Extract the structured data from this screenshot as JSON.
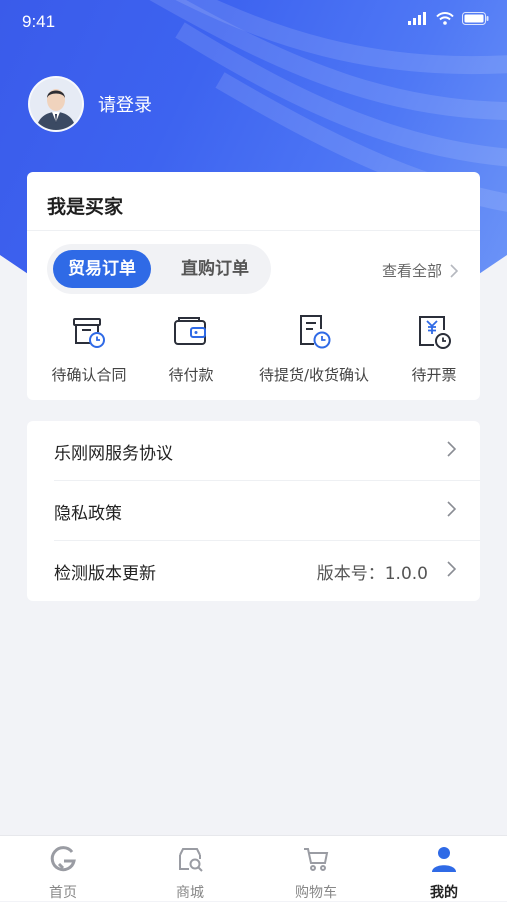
{
  "status_bar": {
    "time": "9:41"
  },
  "profile": {
    "login_text": "请登录"
  },
  "buyer_card": {
    "title": "我是买家",
    "tabs": [
      {
        "label": "贸易订单",
        "active": true
      },
      {
        "label": "直购订单",
        "active": false
      }
    ],
    "view_all": "查看全部",
    "statuses": [
      {
        "label": "待确认合同",
        "icon": "contract-clock-icon"
      },
      {
        "label": "待付款",
        "icon": "wallet-icon"
      },
      {
        "label": "待提货/收货确认",
        "icon": "document-clock-icon"
      },
      {
        "label": "待开票",
        "icon": "invoice-yen-icon"
      }
    ]
  },
  "menu": [
    {
      "label": "乐刚网服务协议",
      "value": ""
    },
    {
      "label": "隐私政策",
      "value": ""
    },
    {
      "label": "检测版本更新",
      "value": "版本号：1.0.0"
    }
  ],
  "tabbar": [
    {
      "label": "首页",
      "icon": "home-g-icon",
      "active": false
    },
    {
      "label": "商城",
      "icon": "store-search-icon",
      "active": false
    },
    {
      "label": "购物车",
      "icon": "cart-icon",
      "active": false
    },
    {
      "label": "我的",
      "icon": "user-icon",
      "active": true
    }
  ],
  "colors": {
    "accent": "#2f6ae6",
    "hero": "#3d63f0",
    "background": "#f2f3f7"
  }
}
